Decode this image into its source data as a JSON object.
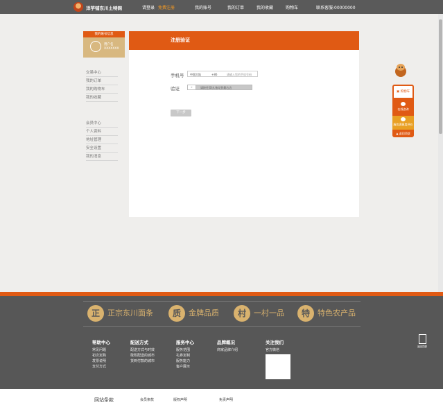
{
  "topbar": {
    "brand": "洋芋铺东川土特网",
    "login": "请登录",
    "register": "免费注册",
    "my_account": "我的账号",
    "my_orders": "我的订单",
    "my_favorites": "我的收藏",
    "cart": "购物车",
    "hotline": "联系客服:00000000"
  },
  "account": {
    "header": "我的账号信息",
    "name": "用户名",
    "id": "XXXXXXX"
  },
  "menu": {
    "group1": [
      "交易中心",
      "我的订单",
      "我的购物车",
      "我的收藏"
    ],
    "group2": [
      "会员中心",
      "个人资料",
      "地址管理",
      "安全设置",
      "我的消息"
    ]
  },
  "panel": {
    "title": "注册验证",
    "phone_label": "手机号",
    "region": "中国大陆",
    "code": "+86",
    "phone_placeholder": "请输入您的手机号码",
    "verify_label": "验证",
    "slider_handle": "»",
    "slider_text": "请按住滑块,拖动到最右边",
    "next": "下一步"
  },
  "widget": {
    "cart": "购物车",
    "chat": "在线咨询",
    "eval": "服务满意度评价",
    "top": "返回顶部"
  },
  "footer": {
    "promises": [
      {
        "mark": "正",
        "text": "正宗东川面条"
      },
      {
        "mark": "质",
        "text": "金牌品质"
      },
      {
        "mark": "村",
        "text": "一村一品"
      },
      {
        "mark": "特",
        "text": "特色农产品"
      }
    ],
    "columns": [
      {
        "title": "帮助中心",
        "items": [
          "常见问题",
          "初次定购",
          "发票说明",
          "支付方式"
        ]
      },
      {
        "title": "配送方式",
        "items": [
          "配送方式与时效",
          "敢附配送的城市",
          "货到付款的城市"
        ]
      },
      {
        "title": "服务中心",
        "items": [
          "服务范围",
          "礼券定制",
          "服务能力",
          "客户展示"
        ]
      },
      {
        "title": "品牌概况",
        "items": [
          "商家品牌介绍"
        ]
      },
      {
        "title": "关注我们",
        "items": [
          "官方微信"
        ]
      }
    ],
    "back_top": "返回顶部"
  },
  "bottom": {
    "title": "网站条款",
    "links": [
      "会员条款",
      "版权声明",
      "免责声明"
    ]
  },
  "colors": {
    "accent": "#e05a14",
    "gold": "#d9b26e",
    "dark": "#575757"
  }
}
